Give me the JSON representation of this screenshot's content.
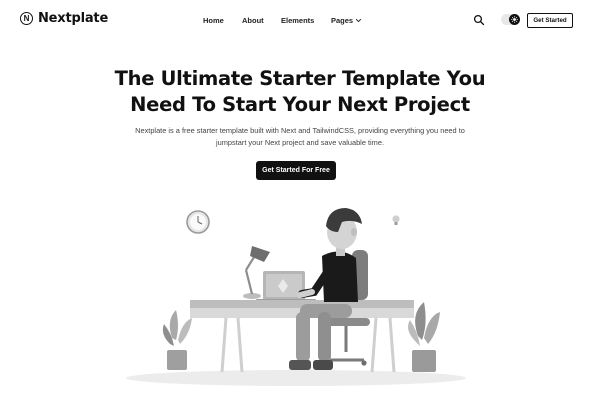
{
  "header": {
    "brand": "Nextplate",
    "brand_mark": "N",
    "nav": [
      {
        "label": "Home"
      },
      {
        "label": "About"
      },
      {
        "label": "Elements"
      },
      {
        "label": "Pages"
      }
    ],
    "cta_label": "Get Started",
    "icons": {
      "search": "search-icon",
      "theme": "theme-toggle-icon",
      "dropdown": "chevron-down-icon"
    }
  },
  "hero": {
    "title_line1": "The Ultimate Starter Template You",
    "title_line2": "Need To Start Your Next Project",
    "desc_line1": "Nextplate is a free starter template built with Next and TailwindCSS, providing everything you need to",
    "desc_line2": "jumpstart your Next project and save valuable time.",
    "cta_label": "Get Started For Free"
  },
  "colors": {
    "primary": "#111111",
    "background": "#ffffff",
    "text_muted": "#444444"
  }
}
